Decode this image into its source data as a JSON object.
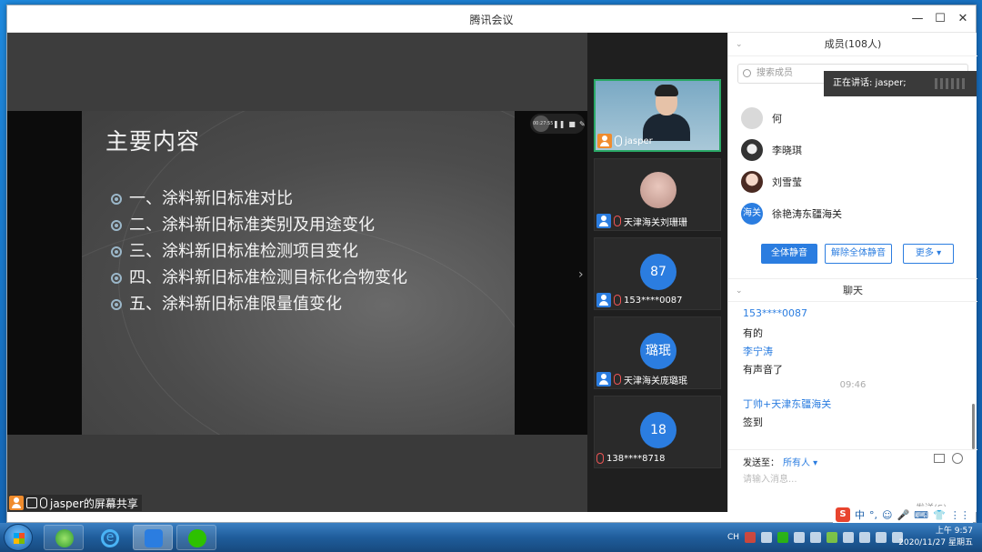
{
  "window": {
    "title": "腾讯会议",
    "min_label": "—",
    "max_label": "☐",
    "close_label": "✕"
  },
  "slide": {
    "title": "主要内容",
    "items": [
      "一、涂料新旧标准对比",
      "二、涂料新旧标准类别及用途变化",
      "三、涂料新旧标准检测项目变化",
      "四、涂料新旧标准检测目标化合物变化",
      "五、涂料新旧标准限量值变化"
    ],
    "recording_time": "00:27:55"
  },
  "share_label": "jasper的屏幕共享",
  "videos": [
    {
      "name": "jasper",
      "type": "camera",
      "active": true
    },
    {
      "name": "天津海关刘珊珊",
      "type": "photo",
      "muted": true
    },
    {
      "name": "153****0087",
      "type": "circle",
      "circle_text": "87",
      "muted": true
    },
    {
      "name": "天津海关庞璐珉",
      "type": "circle",
      "circle_text": "璐珉",
      "muted": true
    },
    {
      "name": "138****8718",
      "type": "circle",
      "circle_text": "18",
      "muted": true
    }
  ],
  "members_panel": {
    "header": "成员(108人)",
    "search_placeholder": "搜索成员",
    "members": [
      {
        "name": "何",
        "avatar": "grey"
      },
      {
        "name": "李晓琪",
        "avatar": "dark"
      },
      {
        "name": "刘雪莹",
        "avatar": "girl"
      },
      {
        "name": "徐艳涛东疆海关",
        "avatar": "blue",
        "avatar_text": "海关"
      }
    ],
    "mute_all": "全体静音",
    "unmute_all": "解除全体静音",
    "more": "更多 ▾"
  },
  "chat": {
    "header": "聊天",
    "messages": [
      {
        "kind": "name",
        "text": "153****0087"
      },
      {
        "kind": "text",
        "text": "有的"
      },
      {
        "kind": "name",
        "text": "李宁涛"
      },
      {
        "kind": "text",
        "text": "有声音了"
      },
      {
        "kind": "time",
        "text": "09:46"
      },
      {
        "kind": "name",
        "text": "丁帅+天津东疆海关"
      },
      {
        "kind": "text",
        "text": "签到"
      }
    ],
    "send_to_label": "发送至：",
    "send_to_value": "所有人 ▾",
    "input_placeholder": "请输入消息...",
    "send_button": "发送(S)"
  },
  "speaking_tooltip": "正在讲话: jasper;",
  "taskbar": {
    "ime": [
      "中",
      "°,",
      "☺",
      "🎤",
      "⌨",
      "👕",
      "⋮⋮"
    ],
    "time": "上午 9:57",
    "date": "2020/11/27 星期五",
    "lang": "CH"
  },
  "colors": {
    "accent": "#2b7de0",
    "active_speaker_border": "#2aa866",
    "presenter_badge": "#f08c2d"
  }
}
